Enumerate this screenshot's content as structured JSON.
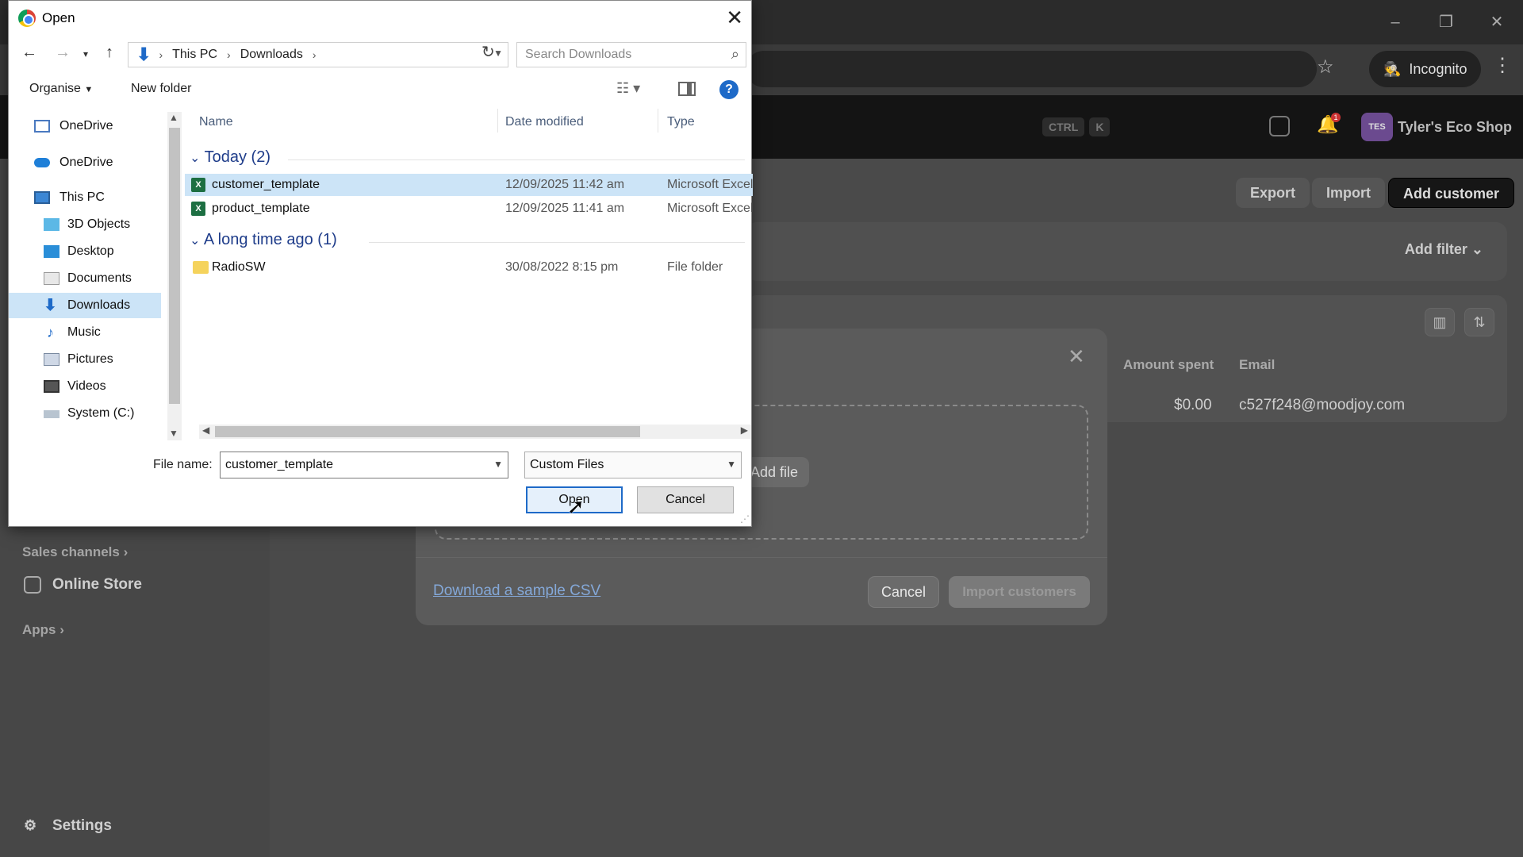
{
  "browser": {
    "incognito_label": "Incognito"
  },
  "app": {
    "shortcut_keys": [
      "CTRL",
      "K"
    ],
    "notification_count": "1",
    "shop_initials": "TES",
    "shop_name": "Tyler's Eco Shop",
    "page_buttons": {
      "export": "Export",
      "import": "Import",
      "add_customer": "Add customer"
    },
    "add_filter": "Add filter",
    "table": {
      "columns": [
        "Amount spent",
        "Email"
      ],
      "rows": [
        {
          "amount": "$0.00",
          "email": "c527f248@moodjoy.com"
        }
      ]
    },
    "sidebar": {
      "sales_channels": "Sales channels",
      "online_store": "Online Store",
      "apps": "Apps",
      "settings": "Settings"
    },
    "import_modal": {
      "add_file": "Add file",
      "sample_link": "Download a sample CSV",
      "cancel": "Cancel",
      "import": "Import customers"
    }
  },
  "dialog": {
    "title": "Open",
    "breadcrumb": [
      "This PC",
      "Downloads"
    ],
    "search_placeholder": "Search Downloads",
    "organise": "Organise",
    "new_folder": "New folder",
    "nav_items": [
      {
        "label": "OneDrive"
      },
      {
        "label": "OneDrive"
      },
      {
        "label": "This PC"
      },
      {
        "label": "3D Objects"
      },
      {
        "label": "Desktop"
      },
      {
        "label": "Documents"
      },
      {
        "label": "Downloads"
      },
      {
        "label": "Music"
      },
      {
        "label": "Pictures"
      },
      {
        "label": "Videos"
      },
      {
        "label": "System (C:)"
      }
    ],
    "columns": {
      "name": "Name",
      "date": "Date modified",
      "type": "Type"
    },
    "groups": [
      {
        "header": "Today (2)",
        "files": [
          {
            "name": "customer_template",
            "date": "12/09/2025 11:42 am",
            "type": "Microsoft Excel"
          },
          {
            "name": "product_template",
            "date": "12/09/2025 11:41 am",
            "type": "Microsoft Excel"
          }
        ]
      },
      {
        "header": "A long time ago (1)",
        "files": [
          {
            "name": "RadioSW",
            "date": "30/08/2022 8:15 pm",
            "type": "File folder"
          }
        ]
      }
    ],
    "file_name_label": "File name:",
    "file_name_value": "customer_template",
    "file_type_filter": "Custom Files",
    "open_button": "Open",
    "cancel_button": "Cancel"
  },
  "colors": {
    "selection": "#cce4f7",
    "accent_blue": "#1e6ac8",
    "excel_green": "#1d6f42"
  }
}
